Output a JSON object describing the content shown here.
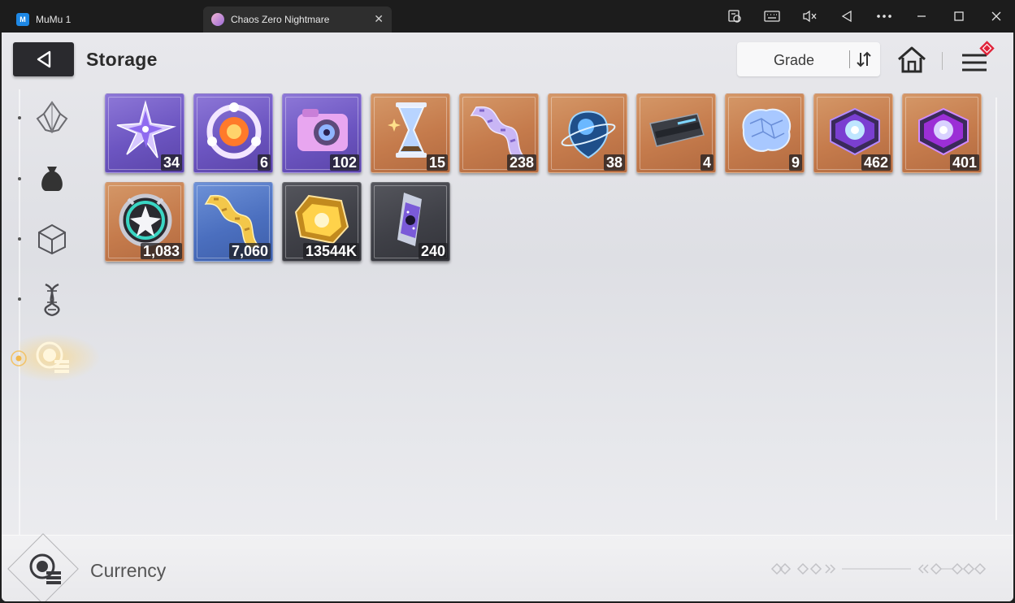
{
  "window": {
    "app_tab": "MuMu 1",
    "app_icon_letter": "M",
    "game_tab": "Chaos Zero Nightmare",
    "close_glyph": "✕"
  },
  "header": {
    "title": "Storage",
    "sort_label": "Grade"
  },
  "categories": [
    {
      "id": "crystal",
      "icon": "crystal-icon",
      "active": false
    },
    {
      "id": "bag",
      "icon": "pouch-icon",
      "active": false
    },
    {
      "id": "cube",
      "icon": "cube-icon",
      "active": false
    },
    {
      "id": "dna",
      "icon": "dna-icon",
      "active": false
    },
    {
      "id": "currency",
      "icon": "currency-icon",
      "active": true
    }
  ],
  "items": [
    {
      "name": "purple-crystal-star",
      "count": "34",
      "frame": "purple"
    },
    {
      "name": "orange-core-ring",
      "count": "6",
      "frame": "purple"
    },
    {
      "name": "camera",
      "count": "102",
      "frame": "purple"
    },
    {
      "name": "hourglass",
      "count": "15",
      "frame": "orange"
    },
    {
      "name": "film-ribbon",
      "count": "238",
      "frame": "orange"
    },
    {
      "name": "planet-drop",
      "count": "38",
      "frame": "orange"
    },
    {
      "name": "data-chip",
      "count": "4",
      "frame": "orange"
    },
    {
      "name": "crystal-brain",
      "count": "9",
      "frame": "orange"
    },
    {
      "name": "blue-power-core",
      "count": "462",
      "frame": "orange"
    },
    {
      "name": "purple-power-core",
      "count": "401",
      "frame": "orange"
    },
    {
      "name": "star-medal",
      "count": "1,083",
      "frame": "orange"
    },
    {
      "name": "gold-film-ribbon",
      "count": "7,060",
      "frame": "blue"
    },
    {
      "name": "gold-cube",
      "count": "13544K",
      "frame": "gray"
    },
    {
      "name": "galaxy-capsule",
      "count": "240",
      "frame": "gray"
    }
  ],
  "footer": {
    "label": "Currency"
  },
  "colors": {
    "purple_frame": "#6c55c1",
    "orange_frame": "#c57b4c",
    "blue_frame": "#4b6fbf",
    "gray_frame": "#3f4047",
    "active_glow": "#ffd678",
    "menu_badge": "#e0233a"
  }
}
